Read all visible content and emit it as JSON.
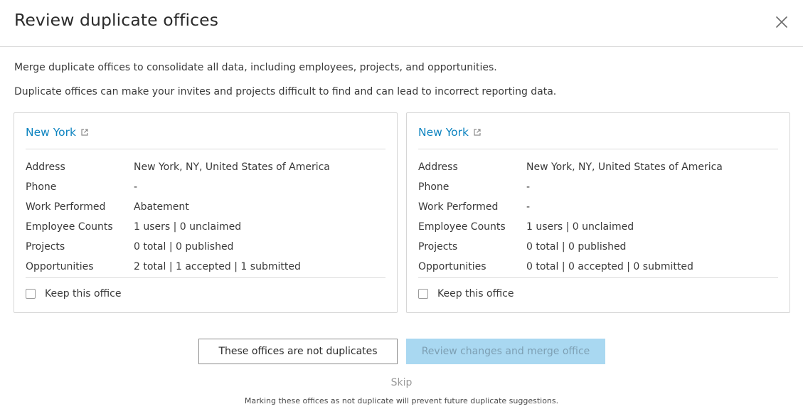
{
  "modal": {
    "title": "Review duplicate offices",
    "close_icon": "close-icon"
  },
  "intro": {
    "line1": "Merge duplicate offices to consolidate all data, including employees, projects, and opportunities.",
    "line2": "Duplicate offices can make your invites and projects difficult to find and can lead to incorrect reporting data."
  },
  "offices": [
    {
      "name": "New York",
      "rows": [
        {
          "label": "Address",
          "value": "New York, NY, United States of America"
        },
        {
          "label": "Phone",
          "value": "-"
        },
        {
          "label": "Work Performed",
          "value": "Abatement"
        },
        {
          "label": "Employee Counts",
          "value": "1 users | 0 unclaimed"
        },
        {
          "label": "Projects",
          "value": "0 total | 0 published"
        },
        {
          "label": "Opportunities",
          "value": "2 total | 1 accepted | 1 submitted"
        }
      ],
      "keep_label": "Keep this office",
      "keep_checked": false
    },
    {
      "name": "New York",
      "rows": [
        {
          "label": "Address",
          "value": "New York, NY, United States of America"
        },
        {
          "label": "Phone",
          "value": "-"
        },
        {
          "label": "Work Performed",
          "value": "-"
        },
        {
          "label": "Employee Counts",
          "value": "1 users | 0 unclaimed"
        },
        {
          "label": "Projects",
          "value": "0 total | 0 published"
        },
        {
          "label": "Opportunities",
          "value": "0 total | 0 accepted | 0 submitted"
        }
      ],
      "keep_label": "Keep this office",
      "keep_checked": false
    }
  ],
  "actions": {
    "not_duplicates_label": "These offices are not duplicates",
    "merge_label": "Review changes and merge office",
    "skip_label": "Skip",
    "note": "Marking these offices as not duplicate will prevent future duplicate suggestions."
  },
  "colors": {
    "link": "#0e84c0",
    "primary_disabled_bg": "#a9d8f1",
    "primary_disabled_text": "#7d9fb3"
  }
}
